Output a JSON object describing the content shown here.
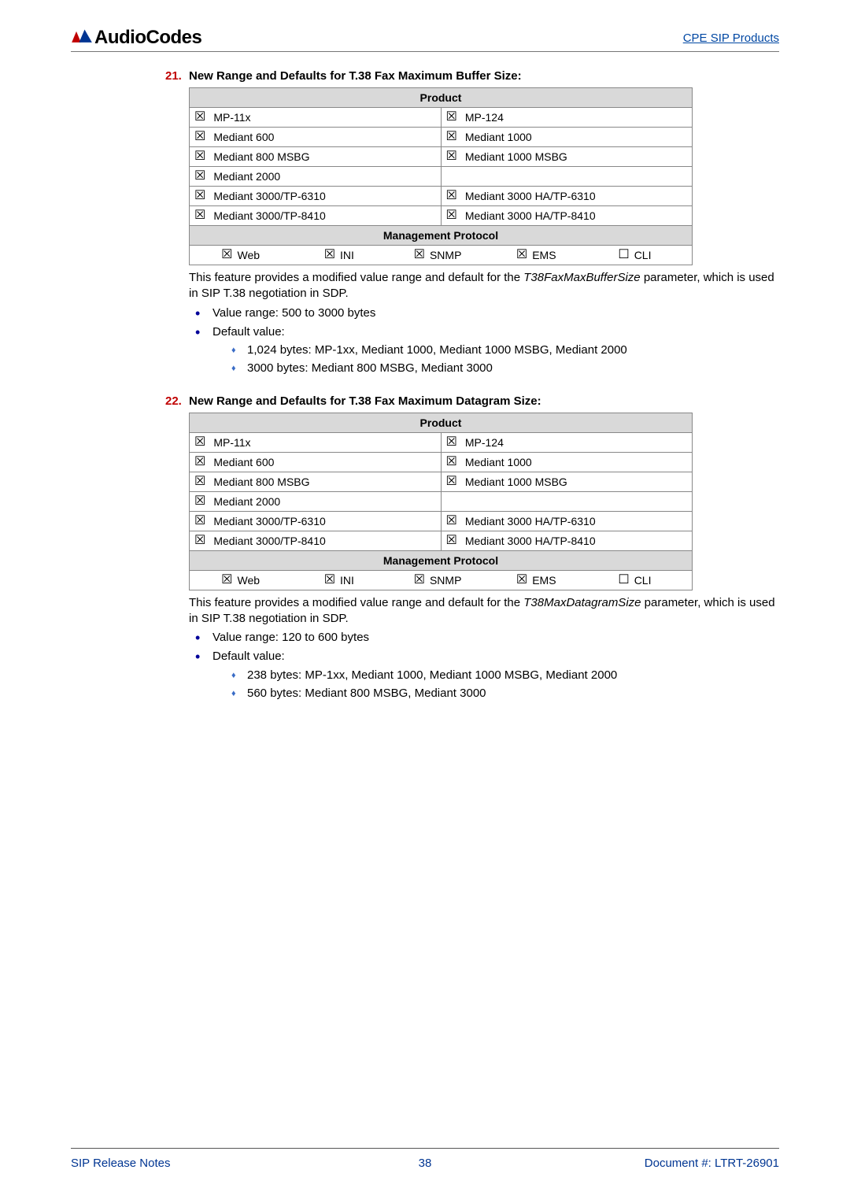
{
  "header": {
    "logo_text": "AudioCodes",
    "right_link": "CPE SIP Products"
  },
  "symbols": {
    "checked": "☒",
    "unchecked": "☐"
  },
  "items": [
    {
      "num": "21.",
      "title": "New Range and Defaults for T.38 Fax Maximum Buffer Size:",
      "table": {
        "product_header": "Product",
        "rows": [
          [
            {
              "checked": true,
              "label": "MP-11x"
            },
            {
              "checked": true,
              "label": "MP-124"
            }
          ],
          [
            {
              "checked": true,
              "label": "Mediant 600"
            },
            {
              "checked": true,
              "label": "Mediant 1000"
            }
          ],
          [
            {
              "checked": true,
              "label": "Mediant 800 MSBG"
            },
            {
              "checked": true,
              "label": "Mediant 1000 MSBG"
            }
          ],
          [
            {
              "checked": true,
              "label": "Mediant 2000"
            },
            null
          ],
          [
            {
              "checked": true,
              "label": "Mediant 3000/TP-6310"
            },
            {
              "checked": true,
              "label": "Mediant 3000 HA/TP-6310"
            }
          ],
          [
            {
              "checked": true,
              "label": "Mediant 3000/TP-8410"
            },
            {
              "checked": true,
              "label": "Mediant 3000 HA/TP-8410"
            }
          ]
        ],
        "mgmt_header": "Management Protocol",
        "mgmt": [
          {
            "checked": true,
            "label": "Web"
          },
          {
            "checked": true,
            "label": "INI"
          },
          {
            "checked": true,
            "label": "SNMP"
          },
          {
            "checked": true,
            "label": "EMS"
          },
          {
            "checked": false,
            "label": "CLI"
          }
        ]
      },
      "desc_pre": "This feature provides a modified value range and default for the ",
      "desc_em": "T38FaxMaxBufferSize",
      "desc_post": " parameter, which is used in SIP T.38 negotiation in SDP.",
      "bullets": [
        {
          "text": "Value range: 500 to 3000 bytes"
        },
        {
          "text": "Default value:",
          "sub": [
            "1,024 bytes: MP-1xx, Mediant 1000, Mediant 1000 MSBG, Mediant 2000",
            "3000 bytes: Mediant 800 MSBG, Mediant 3000"
          ]
        }
      ]
    },
    {
      "num": "22.",
      "title": "New Range and Defaults for T.38 Fax Maximum Datagram Size:",
      "table": {
        "product_header": "Product",
        "rows": [
          [
            {
              "checked": true,
              "label": "MP-11x"
            },
            {
              "checked": true,
              "label": "MP-124"
            }
          ],
          [
            {
              "checked": true,
              "label": "Mediant 600"
            },
            {
              "checked": true,
              "label": "Mediant 1000"
            }
          ],
          [
            {
              "checked": true,
              "label": "Mediant 800 MSBG"
            },
            {
              "checked": true,
              "label": "Mediant 1000 MSBG"
            }
          ],
          [
            {
              "checked": true,
              "label": "Mediant 2000"
            },
            null
          ],
          [
            {
              "checked": true,
              "label": "Mediant 3000/TP-6310"
            },
            {
              "checked": true,
              "label": "Mediant 3000 HA/TP-6310"
            }
          ],
          [
            {
              "checked": true,
              "label": "Mediant 3000/TP-8410"
            },
            {
              "checked": true,
              "label": "Mediant 3000 HA/TP-8410"
            }
          ]
        ],
        "mgmt_header": "Management Protocol",
        "mgmt": [
          {
            "checked": true,
            "label": "Web"
          },
          {
            "checked": true,
            "label": "INI"
          },
          {
            "checked": true,
            "label": "SNMP"
          },
          {
            "checked": true,
            "label": "EMS"
          },
          {
            "checked": false,
            "label": "CLI"
          }
        ]
      },
      "desc_pre": "This feature provides a modified value range and default for the ",
      "desc_em": "T38MaxDatagramSize",
      "desc_post": " parameter, which is used in SIP T.38 negotiation in SDP.",
      "bullets": [
        {
          "text": "Value range: 120 to 600 bytes"
        },
        {
          "text": "Default value:",
          "sub": [
            "238 bytes: MP-1xx, Mediant 1000, Mediant 1000 MSBG, Mediant 2000",
            "560 bytes: Mediant 800 MSBG, Mediant 3000"
          ]
        }
      ]
    }
  ],
  "footer": {
    "left": "SIP Release Notes",
    "center": "38",
    "right": "Document #: LTRT-26901"
  }
}
